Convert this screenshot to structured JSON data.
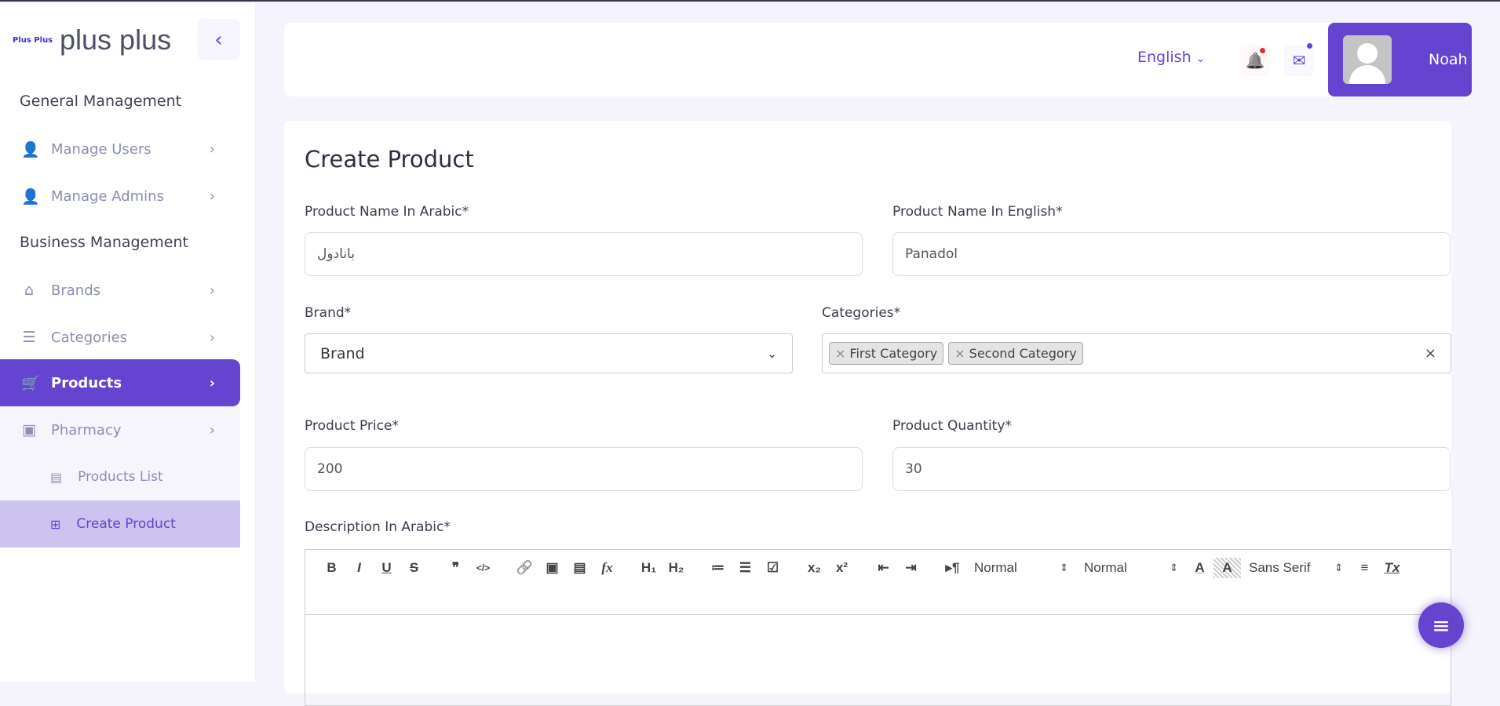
{
  "sidebar": {
    "logo": "Plus Plus",
    "brand": "plus plus",
    "collapse": "‹",
    "sections": [
      "General Management",
      "Business Management"
    ],
    "items": [
      {
        "label": "Manage Users",
        "icon": "👤"
      },
      {
        "label": "Manage Admins",
        "icon": "👤"
      },
      {
        "label": "Brands",
        "icon": "⌂"
      },
      {
        "label": "Categories",
        "icon": "☰"
      },
      {
        "label": "Products",
        "icon": "🛒"
      },
      {
        "label": "Pharmacy",
        "icon": "▣"
      }
    ],
    "subitems": [
      {
        "label": "Products List",
        "icon": "▤"
      },
      {
        "label": "Create Product",
        "icon": "⊞"
      }
    ],
    "chevron": "›"
  },
  "header": {
    "language": "English",
    "language_caret": "⌄",
    "bell": "🔔",
    "mail": "✉",
    "user": "Noah"
  },
  "form": {
    "title": "Create Product",
    "name_ar_label": "Product Name In Arabic*",
    "name_ar_value": "بانادول",
    "name_en_label": "Product Name In English*",
    "name_en_value": "Panadol",
    "brand_label": "Brand*",
    "brand_value": "Brand",
    "brand_caret": "⌄",
    "categories_label": "Categories*",
    "categories": [
      "First Category",
      "Second Category"
    ],
    "tag_remove": "×",
    "clear": "×",
    "price_label": "Product Price*",
    "price_value": "200",
    "qty_label": "Product Quantity*",
    "qty_value": "30",
    "desc_ar_label": "Description In Arabic*"
  },
  "toolbar": {
    "bold": "B",
    "italic": "I",
    "underline": "U",
    "strike": "S",
    "quote": "❞",
    "code": "</>",
    "link": "🔗",
    "image": "▣",
    "video": "▤",
    "formula": "fx",
    "h1": "H₁",
    "h2": "H₂",
    "ol": "≔",
    "ul": "☰",
    "check": "☑",
    "sub": "x₂",
    "sup": "x²",
    "outdent": "⇤",
    "indent": "⇥",
    "direction": "▸¶",
    "size": "Normal",
    "header": "Normal",
    "arrows": "⇕",
    "color": "A",
    "background": "A",
    "font": "Sans Serif",
    "align": "≡",
    "clean": "Tx"
  },
  "fab": "≡"
}
